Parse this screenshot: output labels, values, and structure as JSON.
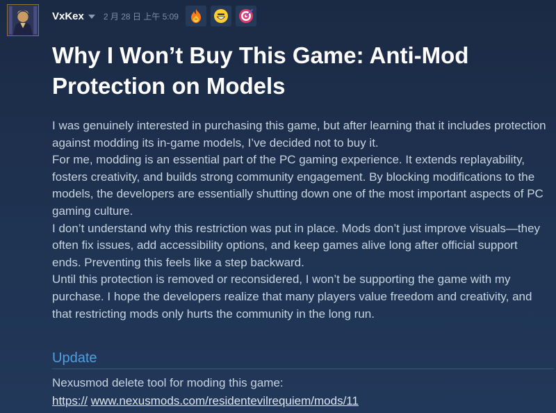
{
  "author": {
    "name": "VxKex",
    "timestamp": "2 月 28 日 上午 5:09"
  },
  "reactions": [
    {
      "icon": "flexing-fire-emoji-icon"
    },
    {
      "icon": "grinning-face-emoji-icon"
    },
    {
      "icon": "bullseye-target-icon"
    }
  ],
  "post": {
    "title": "Why I Won’t Buy This Game: Anti-Mod Protection on Models",
    "paragraphs": [
      "I was genuinely interested in purchasing this game, but after learning that it includes protection against modding its in-game models, I’ve decided not to buy it.",
      "For me, modding is an essential part of the PC gaming experience. It extends replayability, fosters creativity, and builds strong community engagement. By blocking modifications to the models, the developers are essentially shutting down one of the most important aspects of PC gaming culture.",
      "I don’t understand why this restriction was put in place. Mods don’t just improve visuals—they often fix issues, add accessibility options, and keep games alive long after official support ends. Preventing this feels like a step backward.",
      "Until this protection is removed or reconsidered, I won’t be supporting the game with my purchase. I hope the developers realize that many players value freedom and creativity, and that restricting mods only hurts the community in the long run."
    ],
    "update_heading": "Update",
    "update_text": "Nexusmod delete tool for moding this game:",
    "link_scheme": "https://",
    "link_url": "www.nexusmods.com/residentevilrequiem/mods/11"
  },
  "colors": {
    "background": "#1b2a44",
    "title": "#ffffff",
    "body_text": "#c6d4df",
    "update_heading": "#4ca1e4",
    "timestamp": "#7f8fa3"
  }
}
